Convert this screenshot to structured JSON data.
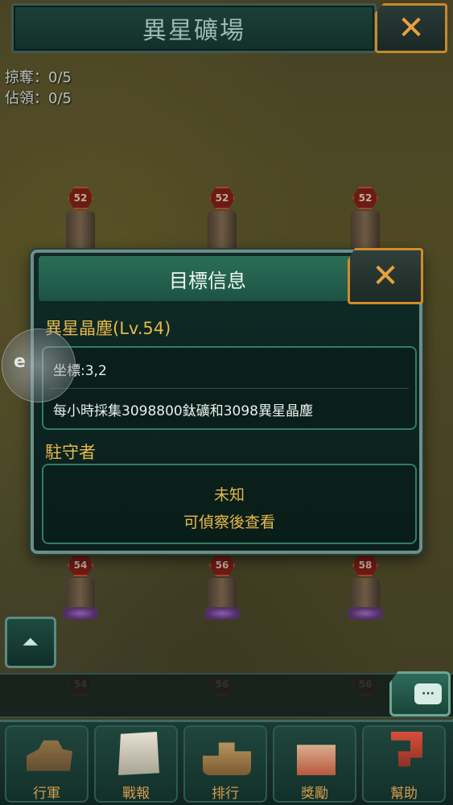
{
  "header": {
    "title": "異星礦場",
    "close_label": "✕"
  },
  "stats": {
    "plunder": "掠奪：0/5",
    "occupy": "佔領：0/5"
  },
  "map": {
    "buildings": [
      {
        "level": "52"
      },
      {
        "level": "52"
      },
      {
        "level": "52"
      },
      {
        "level": "54"
      },
      {
        "level": "56"
      },
      {
        "level": "58"
      },
      {
        "level": "54"
      },
      {
        "level": "56"
      },
      {
        "level": "56"
      }
    ]
  },
  "popup": {
    "title": "目標信息",
    "close_label": "✕",
    "target_name": "異星晶塵(Lv.54)",
    "coordinates": "坐標:3,2",
    "output": "每小時採集3098800鈦礦和3098異星晶塵",
    "garrison_label": "駐守者",
    "garrison_status": "未知",
    "garrison_hint": "可偵察後查看"
  },
  "assistive": {
    "logo": "e"
  },
  "expand_button": {
    "icon": "chevron-up-icon",
    "glyph": "⏶"
  },
  "chat": {
    "icon": "chat-icon",
    "glyph": "···"
  },
  "nav": {
    "items": [
      {
        "label": "行軍",
        "icon": "tank-icon"
      },
      {
        "label": "戰報",
        "icon": "report-icon"
      },
      {
        "label": "排行",
        "icon": "ranking-icon"
      },
      {
        "label": "獎勵",
        "icon": "gift-icon"
      },
      {
        "label": "幫助",
        "icon": "help-icon"
      }
    ]
  },
  "colors": {
    "accent_gold": "#e7b84a",
    "close_orange": "#d38b2a",
    "panel_green": "#2b6e58",
    "level_badge": "#8c2318"
  }
}
